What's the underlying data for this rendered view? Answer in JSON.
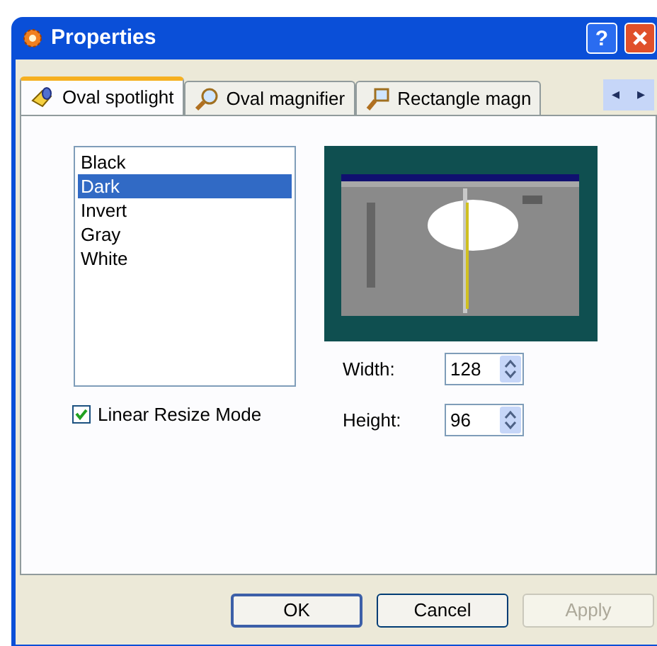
{
  "window": {
    "title": "Properties",
    "buttons": [
      {
        "kind": "help",
        "label": "?"
      },
      {
        "kind": "close"
      }
    ]
  },
  "tabs": [
    {
      "label": "Oval spotlight",
      "kind": "spotlight",
      "selected": true
    },
    {
      "label": "Oval magnifier",
      "kind": "magnifier",
      "selected": false
    },
    {
      "label": "Rectangle magn",
      "kind": "rect",
      "selected": false
    }
  ],
  "tab_scroll": [
    "◂",
    "▸"
  ],
  "modes": [
    {
      "label": "Black",
      "selected": false
    },
    {
      "label": "Dark",
      "selected": true
    },
    {
      "label": "Invert",
      "selected": false
    },
    {
      "label": "Gray",
      "selected": false
    },
    {
      "label": "White",
      "selected": false
    }
  ],
  "linear_resize": {
    "label": "Linear Resize Mode",
    "checked": true
  },
  "fields": [
    {
      "label": "Width:",
      "value": "128"
    },
    {
      "label": "Height:",
      "value": "96"
    }
  ],
  "buttons": [
    {
      "label": "OK",
      "disabled": false,
      "default": true
    },
    {
      "label": "Cancel",
      "disabled": false,
      "default": false
    },
    {
      "label": "Apply",
      "disabled": true,
      "default": false
    }
  ]
}
